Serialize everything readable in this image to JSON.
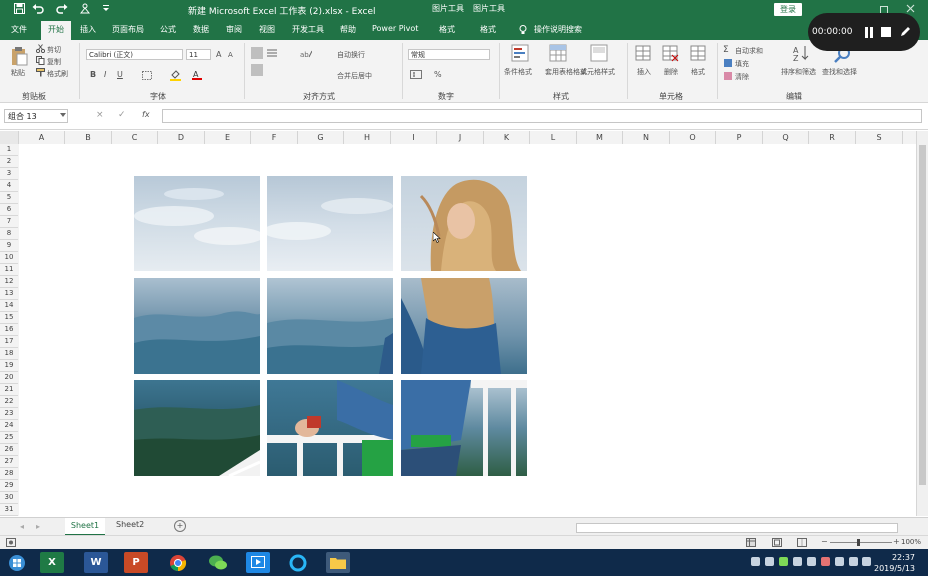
{
  "titlebar": {
    "save_icon": "save-icon",
    "undo_icon": "undo-icon",
    "redo_icon": "redo-icon",
    "doc_title": "新建 Microsoft Excel 工作表 (2).xlsx - Excel",
    "ctx_picture_tools": "图片工具",
    "ctx_drawing_tools": "图片工具",
    "login": "登录"
  },
  "recorder": {
    "time": "00:00:00"
  },
  "tabs": [
    "文件",
    "开始",
    "插入",
    "页面布局",
    "公式",
    "数据",
    "审阅",
    "视图",
    "开发工具",
    "帮助",
    "Power Pivot",
    "格式",
    "格式",
    "操作说明搜索"
  ],
  "active_tab": "开始",
  "ribbon": {
    "clipboard": {
      "paste": "粘贴",
      "cut": "剪切",
      "copy": "复制",
      "format_painter": "格式刷",
      "label": "剪贴板"
    },
    "font": {
      "name": "Calibri (正文)",
      "size": "11",
      "bold": "B",
      "italic": "I",
      "underline": "U",
      "label": "字体"
    },
    "alignment": {
      "wrap": "自动换行",
      "merge": "合并后居中",
      "label": "对齐方式"
    },
    "number": {
      "format": "常规",
      "percent": "%",
      "label": "数字"
    },
    "styles": {
      "conditional": "条件格式",
      "table": "套用表格格式",
      "cell_styles": "单元格样式",
      "label": "样式"
    },
    "cells": {
      "insert": "插入",
      "delete": "删除",
      "format": "格式",
      "label": "单元格"
    },
    "editing": {
      "autosum": "自动求和",
      "fill": "填充",
      "clear": "清除",
      "sort": "排序和筛选",
      "find": "查找和选择",
      "label": "编辑"
    }
  },
  "formula_bar": {
    "name_box": "组合 13",
    "cancel": "×",
    "enter": "✓",
    "fx": "fx",
    "value": ""
  },
  "columns": [
    "A",
    "B",
    "C",
    "D",
    "E",
    "F",
    "G",
    "H",
    "I",
    "J",
    "K",
    "L",
    "M",
    "N",
    "O",
    "P",
    "Q",
    "R",
    "S"
  ],
  "rows": [
    "1",
    "2",
    "3",
    "4",
    "5",
    "6",
    "7",
    "8",
    "9",
    "10",
    "11",
    "12",
    "13",
    "14",
    "15",
    "16",
    "17",
    "18",
    "19",
    "20",
    "21",
    "22",
    "23",
    "24",
    "25",
    "26",
    "27",
    "28",
    "29",
    "30",
    "31"
  ],
  "sheets": {
    "active": "Sheet1",
    "other": "Sheet2",
    "add": "+"
  },
  "status": {
    "zoom": "100%"
  },
  "taskbar": {
    "apps": [
      "windows-start-icon",
      "excel-app-icon",
      "word-app-icon",
      "powerpoint-app-icon",
      "chrome-app-icon",
      "wechat-app-icon",
      "video-app-icon",
      "browser-app-icon",
      "file-explorer-icon"
    ],
    "excel_letter": "X",
    "word_letter": "W",
    "ppt_letter": "P",
    "time": "22:37",
    "date": "2019/5/13"
  },
  "colors": {
    "excel_green": "#217346",
    "taskbar": "#0f2a4a",
    "recorder": "#1f1f1f"
  }
}
